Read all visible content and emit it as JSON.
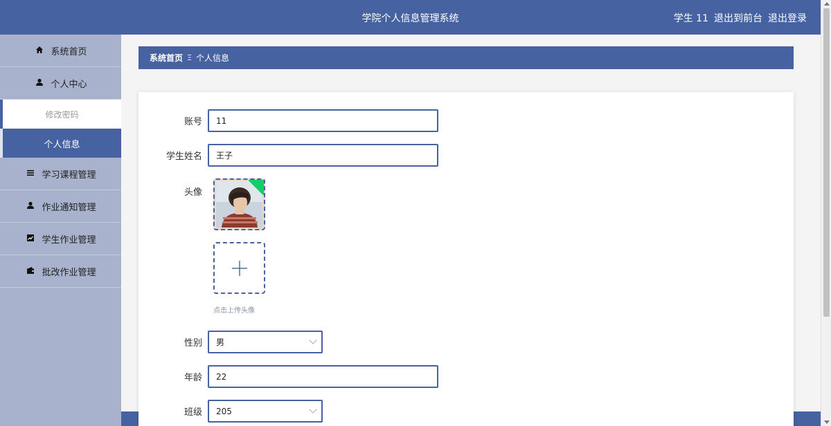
{
  "header": {
    "title": "学院个人信息管理系统",
    "user": "学生 11",
    "back_to_front": "退出到前台",
    "logout": "退出登录"
  },
  "sidebar": {
    "items": [
      {
        "label": "系统首页",
        "icon": "home-icon"
      },
      {
        "label": "个人中心",
        "icon": "user-icon"
      },
      {
        "label": "修改密码",
        "sub": true
      },
      {
        "label": "个人信息",
        "sub": true,
        "active": true
      },
      {
        "label": "学习课程管理",
        "icon": "list-icon"
      },
      {
        "label": "作业通知管理",
        "icon": "user-icon"
      },
      {
        "label": "学生作业管理",
        "icon": "chart-icon"
      },
      {
        "label": "批改作业管理",
        "icon": "wallet-icon"
      }
    ]
  },
  "breadcrumb": {
    "home": "系统首页",
    "separator": "Ξ",
    "current": "个人信息"
  },
  "form": {
    "account_label": "账号",
    "account_value": "11",
    "name_label": "学生姓名",
    "name_value": "王子",
    "avatar_label": "头像",
    "upload_tip": "点击上传头像",
    "gender_label": "性别",
    "gender_value": "男",
    "age_label": "年龄",
    "age_value": "22",
    "class_label": "班级",
    "class_value": "205"
  },
  "colors": {
    "primary": "#4762a1",
    "sidebar_bg": "#a8b2cc",
    "success": "#13ce66"
  }
}
